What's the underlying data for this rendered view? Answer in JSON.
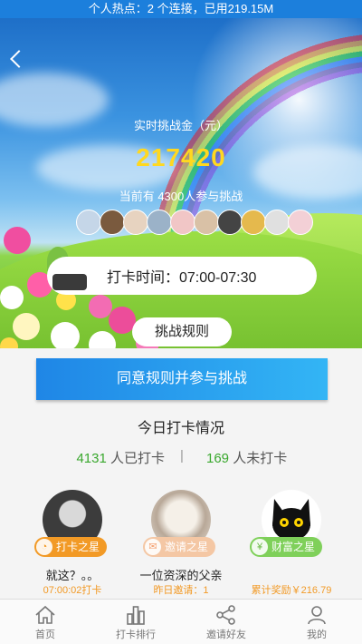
{
  "status_bar": {
    "text": "个人热点：2 个连接，已用219.15M"
  },
  "hero": {
    "gold_label": "实时挑战金（元）",
    "gold_amount": "217420",
    "participants_text": "当前有 4300人参与挑战",
    "checkin_time": "打卡时间：07:00-07:30",
    "rules_button": "挑战规则",
    "avatar_colors": [
      "#c5d6e8",
      "#7a5a3e",
      "#e7d3c0",
      "#9bb2c8",
      "#f1c6c6",
      "#d9c1a6",
      "#444444",
      "#e5b94d",
      "#e0e0e0",
      "#f3d0d6"
    ]
  },
  "join_button": "同意规则并参与挑战",
  "today": {
    "title": "今日打卡情况",
    "checked_count": "4131",
    "checked_label": " 人已打卡",
    "separator": "|",
    "unchecked_count": "169",
    "unchecked_label": " 人未打卡"
  },
  "stars": [
    {
      "badge": "打卡之星",
      "badge_color": "#f29a26",
      "name": "就这？。。",
      "sub": "07:00:02打卡"
    },
    {
      "badge": "邀请之星",
      "badge_color": "#f4c7a4",
      "name": "一位资深的父亲",
      "sub": "昨日邀请：1"
    },
    {
      "badge": "财富之星",
      "badge_color": "#7fd05a",
      "name": "",
      "sub": "累计奖励￥216.79"
    }
  ],
  "tabbar": {
    "items": [
      {
        "label": "首页",
        "icon": "home-icon"
      },
      {
        "label": "打卡排行",
        "icon": "ranking-icon"
      },
      {
        "label": "邀请好友",
        "icon": "share-icon"
      },
      {
        "label": "我的",
        "icon": "user-icon"
      }
    ]
  }
}
